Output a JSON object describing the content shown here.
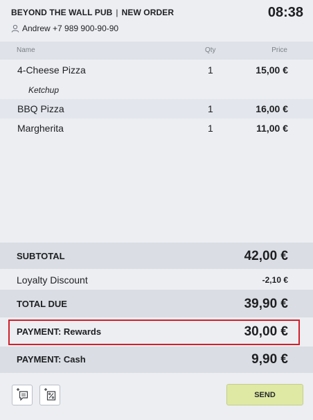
{
  "header": {
    "venue": "BEYOND THE WALL PUB",
    "separator": "|",
    "order_type": "NEW ORDER",
    "time": "08:38",
    "customer": "Andrew +7 989 900-90-90"
  },
  "columns": {
    "name": "Name",
    "qty": "Qty",
    "price": "Price"
  },
  "items": [
    {
      "name": "4-Cheese Pizza",
      "qty": "1",
      "price": "15,00 €"
    },
    {
      "modifier": "Ketchup"
    },
    {
      "name": "BBQ Pizza",
      "qty": "1",
      "price": "16,00 €"
    },
    {
      "name": "Margherita",
      "qty": "1",
      "price": "11,00 €"
    }
  ],
  "totals": {
    "subtotal_label": "SUBTOTAL",
    "subtotal_value": "42,00 €",
    "discount_label": "Loyalty Discount",
    "discount_value": "-2,10 €",
    "total_label": "TOTAL DUE",
    "total_value": "39,90 €",
    "payment_rewards_label": "PAYMENT: Rewards",
    "payment_rewards_value": "30,00 €",
    "payment_cash_label": "PAYMENT: Cash",
    "payment_cash_value": "9,90 €"
  },
  "footer": {
    "comment_icon": "add-comment-icon",
    "discount_icon": "add-discount-icon",
    "send_label": "SEND"
  },
  "colors": {
    "highlight_border": "#d11f2a",
    "send_button": "#dfe9a3"
  }
}
